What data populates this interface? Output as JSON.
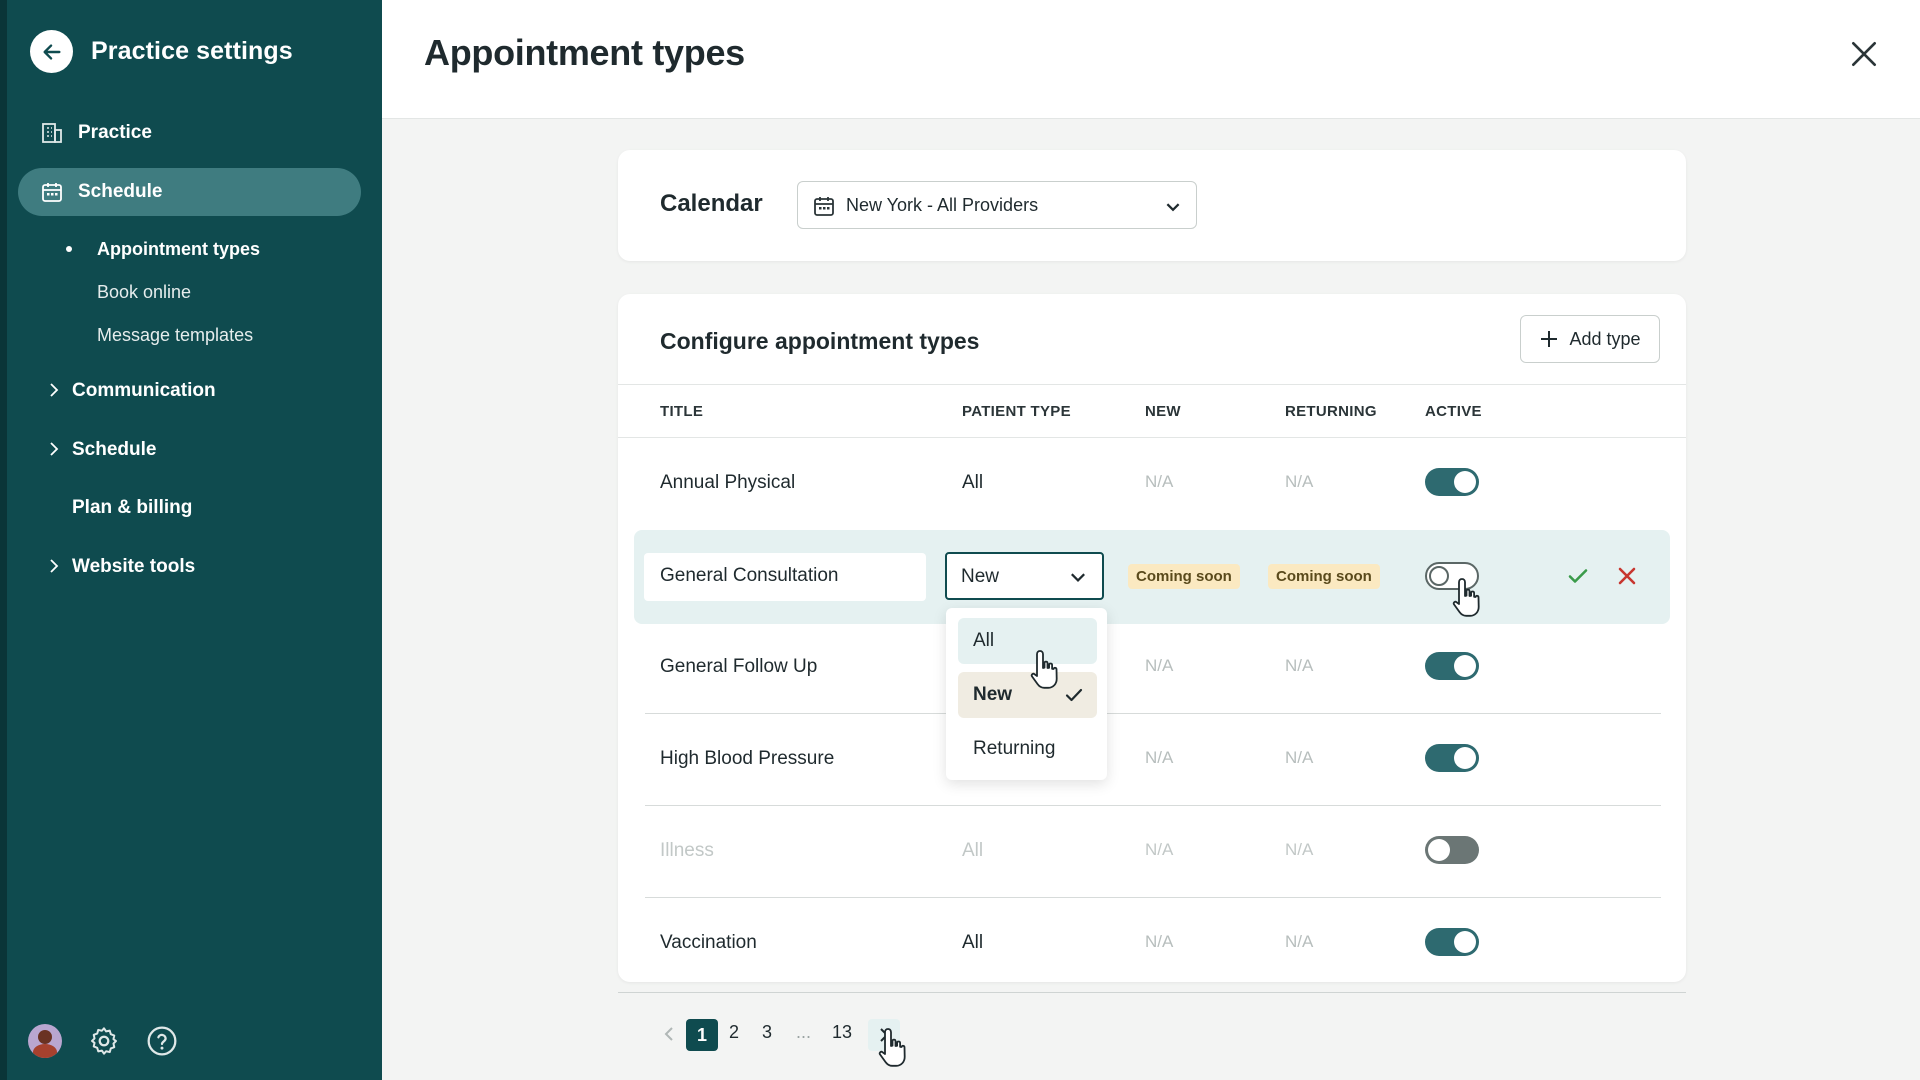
{
  "sidebar": {
    "title": "Practice settings",
    "nav": [
      {
        "label": "Practice",
        "icon": "building-icon"
      },
      {
        "label": "Schedule",
        "icon": "calendar-icon",
        "active": true
      }
    ],
    "schedule_sub": [
      "Appointment types",
      "Book online",
      "Message templates"
    ],
    "groups": [
      {
        "label": "Communication",
        "expandable": true
      },
      {
        "label": "Schedule",
        "expandable": true
      },
      {
        "label": "Plan & billing",
        "expandable": false
      },
      {
        "label": "Website tools",
        "expandable": true
      }
    ]
  },
  "header": {
    "title": "Appointment types"
  },
  "calendar": {
    "label": "Calendar",
    "value": "New York - All Providers"
  },
  "types": {
    "title": "Configure appointment types",
    "add_label": "Add type",
    "columns": [
      "TITLE",
      "PATIENT TYPE",
      "NEW",
      "RETURNING",
      "ACTIVE"
    ],
    "rows": [
      {
        "title": "Annual Physical",
        "patient_type": "All",
        "new": "N/A",
        "returning": "N/A",
        "active": true
      },
      {
        "title": "General Consultation",
        "patient_type": "New",
        "new": "Coming soon",
        "returning": "Coming soon",
        "active": false,
        "editing": true
      },
      {
        "title": "General Follow Up",
        "patient_type": "",
        "new": "N/A",
        "returning": "N/A",
        "active": true
      },
      {
        "title": "High Blood Pressure",
        "patient_type": "",
        "new": "N/A",
        "returning": "N/A",
        "active": true
      },
      {
        "title": "Illness",
        "patient_type": "All",
        "new": "N/A",
        "returning": "N/A",
        "active": false,
        "disabled": true
      },
      {
        "title": "Vaccination",
        "patient_type": "All",
        "new": "N/A",
        "returning": "N/A",
        "active": true
      }
    ],
    "dropdown_options": [
      "All",
      "New",
      "Returning"
    ],
    "dropdown_selected": "New"
  },
  "pagination": {
    "pages": [
      "1",
      "2",
      "3",
      "...",
      "13"
    ],
    "current": "1"
  },
  "colors": {
    "sidebar_bg": "#0f4b4f",
    "accent": "#2e6a70",
    "badge_bg": "#fbe9c1",
    "confirm": "#3a9b4a",
    "cancel": "#c7362f"
  }
}
